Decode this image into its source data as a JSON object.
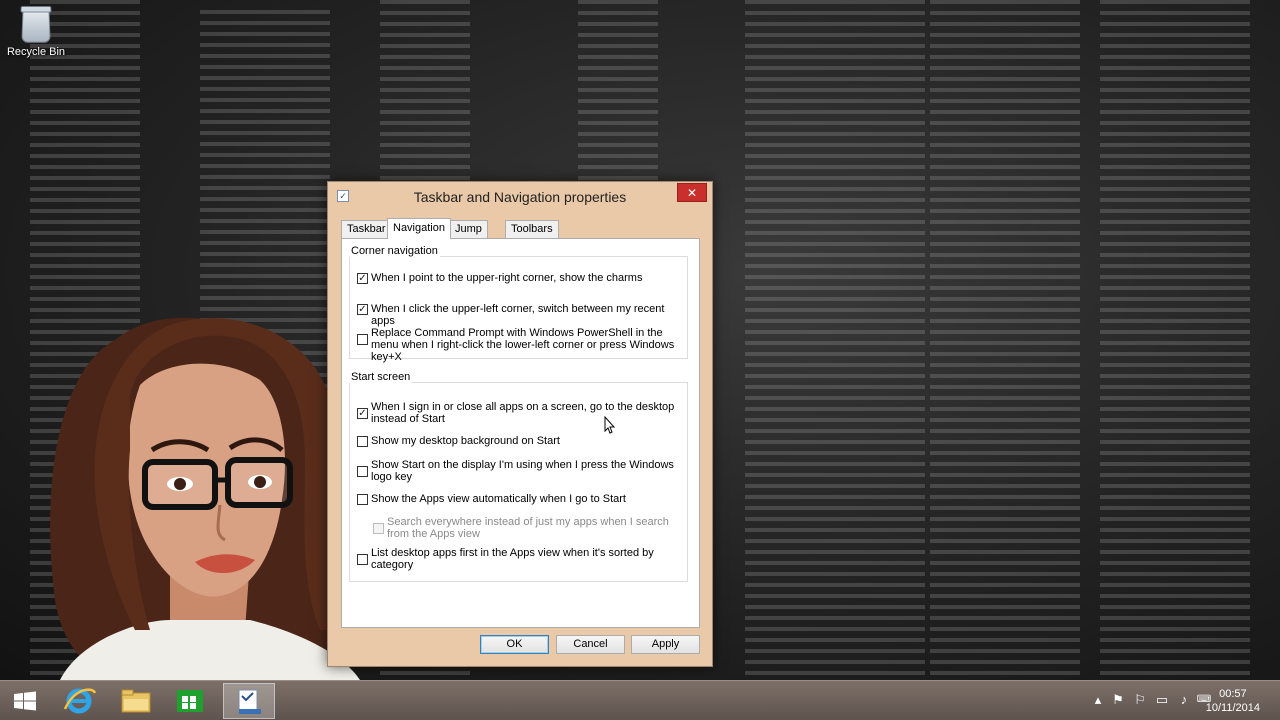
{
  "desktop": {
    "recycle_bin_label": "Recycle Bin"
  },
  "dialog": {
    "title": "Taskbar and Navigation properties",
    "close_glyph": "✕",
    "tabs": [
      {
        "label": "Taskbar",
        "active": false
      },
      {
        "label": "Navigation",
        "active": true
      },
      {
        "label": "Jump Lists",
        "active": false
      },
      {
        "label": "Toolbars",
        "active": false
      }
    ],
    "corner_navigation": {
      "title": "Corner navigation",
      "options": [
        {
          "label": "When I point to the upper-right corner, show the charms",
          "checked": true
        },
        {
          "label": "When I click the upper-left corner, switch between my recent apps",
          "checked": true
        },
        {
          "label": "Replace Command Prompt with Windows PowerShell in the menu when I right-click the lower-left corner or press Windows key+X",
          "checked": false
        }
      ]
    },
    "start_screen": {
      "title": "Start screen",
      "options": [
        {
          "label": "When I sign in or close all apps on a screen, go to the desktop instead of Start",
          "checked": true
        },
        {
          "label": "Show my desktop background on Start",
          "checked": false
        },
        {
          "label": "Show Start on the display I'm using when I press the Windows logo key",
          "checked": false
        },
        {
          "label": "Show the Apps view automatically when I go to Start",
          "checked": false
        },
        {
          "label": "Search everywhere instead of just my apps when I search from the Apps view",
          "checked": false,
          "disabled": true
        },
        {
          "label": "List desktop apps first in the Apps view when it's sorted by category",
          "checked": false
        }
      ]
    },
    "buttons": {
      "ok": "OK",
      "cancel": "Cancel",
      "apply": "Apply"
    }
  },
  "taskbar": {
    "apps": [
      "start-button",
      "internet-explorer",
      "file-explorer",
      "windows-store",
      "taskbar-properties"
    ],
    "clock": {
      "time": "00:57",
      "date": "10/11/2014"
    }
  },
  "colors": {
    "dialog_frame": "#e9c9a8",
    "close_button": "#c9302c",
    "taskbar": "#6e625b"
  }
}
